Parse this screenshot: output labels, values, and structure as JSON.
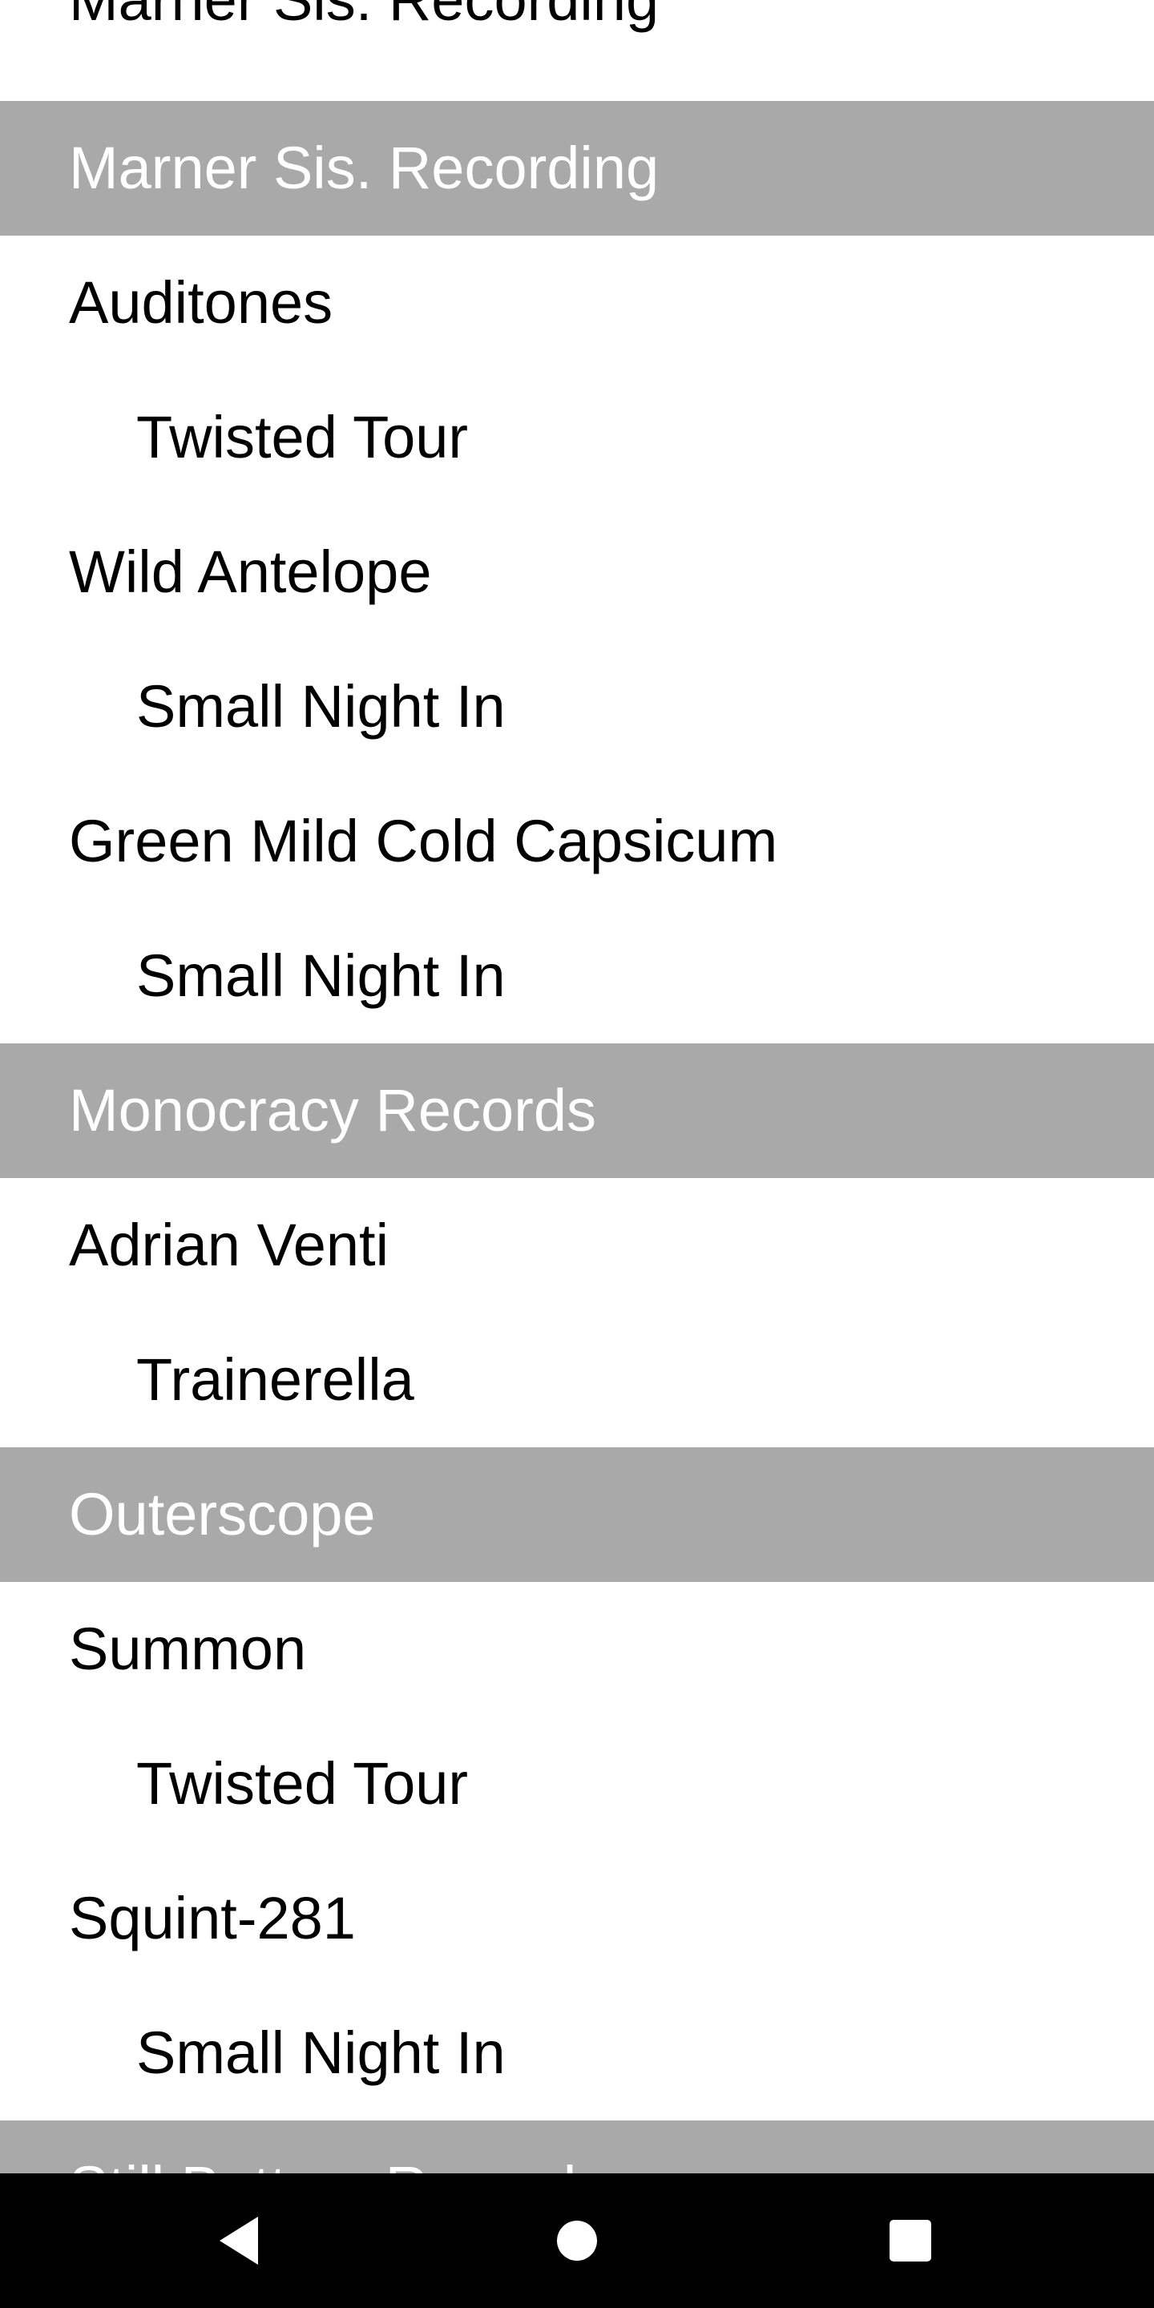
{
  "list": {
    "partial_top_label": "Marner Sis. Recording",
    "rows": [
      {
        "kind": "header",
        "label": "Marner Sis. Recording"
      },
      {
        "kind": "artist",
        "label": "Auditones"
      },
      {
        "kind": "album",
        "label": "Twisted Tour"
      },
      {
        "kind": "artist",
        "label": "Wild Antelope"
      },
      {
        "kind": "album",
        "label": "Small Night In"
      },
      {
        "kind": "artist",
        "label": "Green Mild Cold Capsicum"
      },
      {
        "kind": "album",
        "label": "Small Night In"
      },
      {
        "kind": "header",
        "label": "Monocracy Records"
      },
      {
        "kind": "artist",
        "label": "Adrian Venti"
      },
      {
        "kind": "album",
        "label": "Trainerella"
      },
      {
        "kind": "header",
        "label": "Outerscope"
      },
      {
        "kind": "artist",
        "label": "Summon"
      },
      {
        "kind": "album",
        "label": "Twisted Tour"
      },
      {
        "kind": "artist",
        "label": "Squint-281"
      },
      {
        "kind": "album",
        "label": "Small Night In"
      },
      {
        "kind": "header",
        "label": "Still Bottom Records"
      }
    ]
  },
  "navbar": {
    "back_icon": "triangle-back-icon",
    "home_icon": "circle-home-icon",
    "recents_icon": "square-recents-icon",
    "icon_color": "#ffffff",
    "background_color": "#000000"
  },
  "colors": {
    "header_background": "#a9a9a9",
    "header_text": "#ffffff",
    "item_text": "#000000",
    "background": "#ffffff"
  }
}
